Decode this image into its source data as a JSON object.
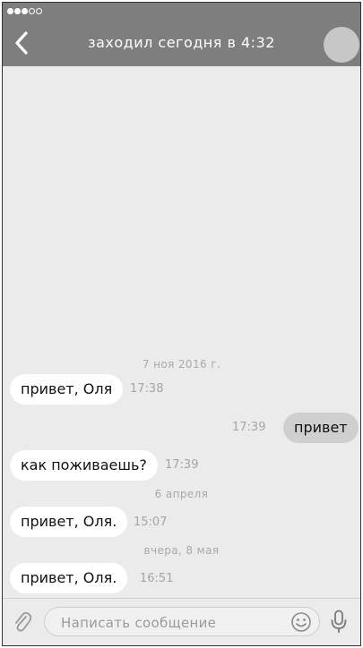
{
  "status_bar": {
    "signal_dots": [
      "on",
      "on",
      "on",
      "off",
      "off"
    ]
  },
  "header": {
    "back_icon": "chevron-left-icon",
    "title": "заходил сегодня в 4:32",
    "avatar": "avatar-circle"
  },
  "messages": [
    {
      "kind": "date",
      "text": "7 ноя 2016 г."
    },
    {
      "kind": "incoming",
      "text": "привет, Оля",
      "time": "17:38"
    },
    {
      "kind": "outgoing",
      "text": "привет",
      "time": "17:39"
    },
    {
      "kind": "incoming",
      "text": "как поживаешь?",
      "time": "17:39"
    },
    {
      "kind": "date",
      "text": "6 апреля"
    },
    {
      "kind": "incoming",
      "text": "привет, Оля.",
      "time": "15:07"
    },
    {
      "kind": "date",
      "text": "вчера, 8 мая"
    },
    {
      "kind": "incoming",
      "text": "привет, Оля.",
      "time": "16:51"
    }
  ],
  "composer": {
    "attach_icon": "paperclip-icon",
    "placeholder": "Написать сообщение",
    "emoji_icon": "smiley-icon",
    "mic_icon": "microphone-icon"
  },
  "colors": {
    "header_bg": "#7e7e7e",
    "chat_bg": "#ebebeb",
    "incoming_bubble": "#ffffff",
    "outgoing_bubble": "#cfcfcf"
  }
}
